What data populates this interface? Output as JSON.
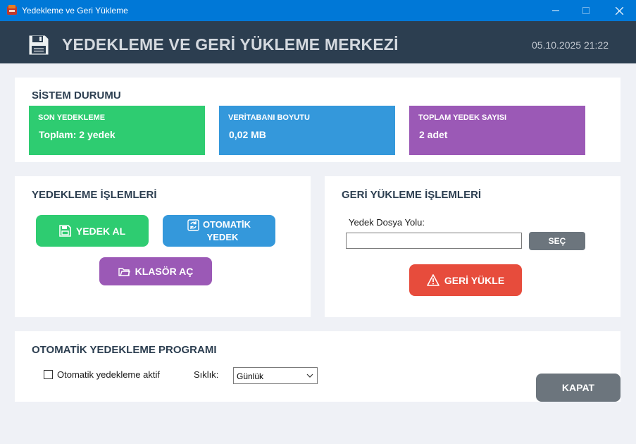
{
  "window": {
    "title": "Yedekleme ve Geri Yükleme",
    "minimize": "—",
    "maximize": "☐",
    "close": "✕"
  },
  "header": {
    "title": "YEDEKLEME VE GERİ YÜKLEME MERKEZİ",
    "datetime": "05.10.2025 21:22"
  },
  "system_status": {
    "title": "SİSTEM DURUMU",
    "cards": [
      {
        "label": "SON YEDEKLEME",
        "value": "Toplam: 2 yedek",
        "color": "#2ecc71"
      },
      {
        "label": "VERİTABANI BOYUTU",
        "value": "0,02 MB",
        "color": "#3498db"
      },
      {
        "label": "TOPLAM YEDEK SAYISI",
        "value": "2 adet",
        "color": "#9b59b6"
      }
    ]
  },
  "backup_ops": {
    "title": "YEDEKLEME İŞLEMLERİ",
    "backup_button": "YEDEK AL",
    "auto_backup_line1": "OTOMATİK",
    "auto_backup_line2": "YEDEK",
    "open_folder_button": "KLASÖR AÇ"
  },
  "restore_ops": {
    "title": "GERİ YÜKLEME İŞLEMLERİ",
    "path_label": "Yedek Dosya Yolu:",
    "path_value": "",
    "browse_button": "SEÇ",
    "restore_button": "GERİ YÜKLE"
  },
  "schedule": {
    "title": "OTOMATİK YEDEKLEME PROGRAMI",
    "auto_enabled_label": "Otomatik yedekleme aktif",
    "auto_enabled": false,
    "frequency_label": "Sıklık:",
    "frequency_value": "Günlük"
  },
  "footer": {
    "close_button": "KAPAT"
  },
  "colors": {
    "green": "#2ecc71",
    "blue": "#3498db",
    "purple": "#9b59b6",
    "red": "#e74c3c",
    "gray": "#6c757d",
    "header": "#2c3e50",
    "titlebar": "#0078d7"
  }
}
